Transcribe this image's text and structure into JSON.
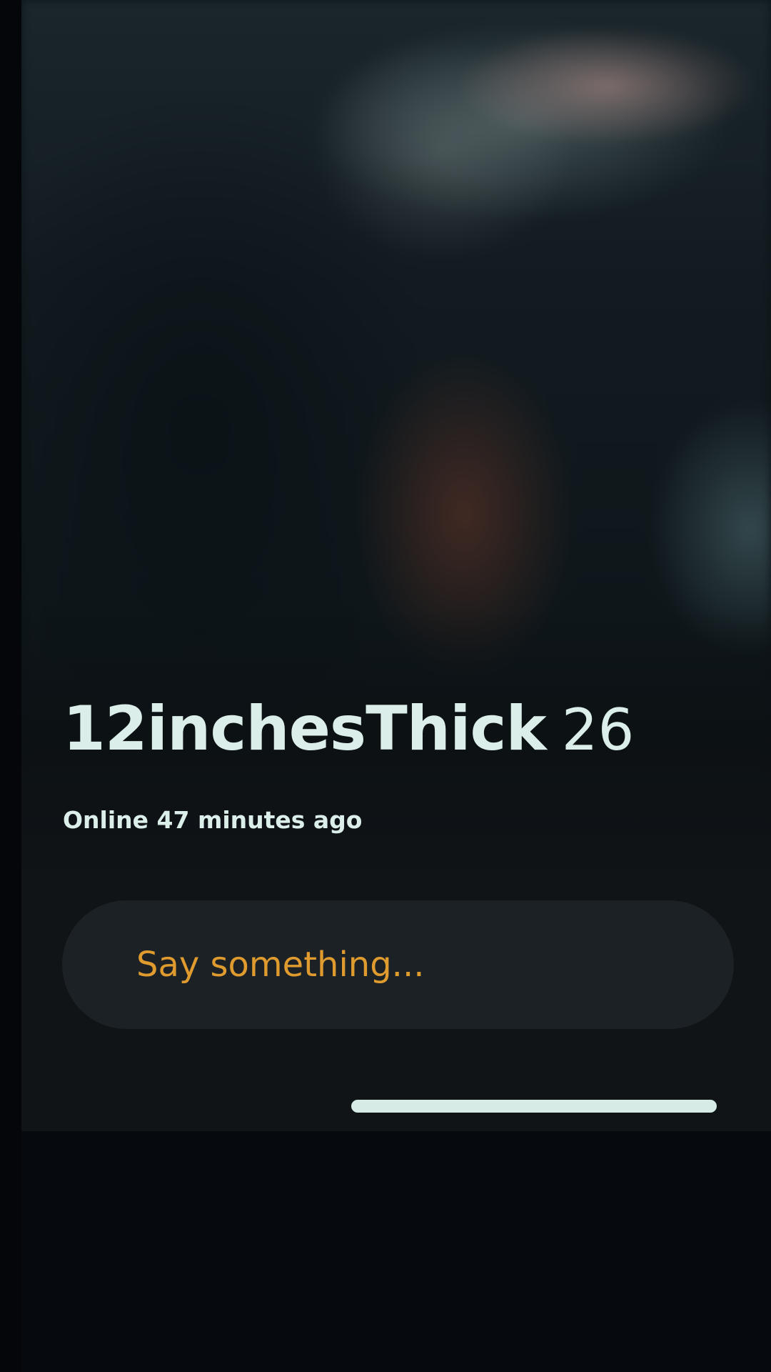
{
  "profile": {
    "username": "12inchesThick",
    "age": "26",
    "status": "Online 47 minutes ago"
  },
  "message": {
    "placeholder": "Say something..."
  },
  "colors": {
    "text_primary": "#dbeee9",
    "accent_placeholder": "#e09b2f",
    "pill_background": "#1c2126",
    "page_background": "#06090d"
  }
}
